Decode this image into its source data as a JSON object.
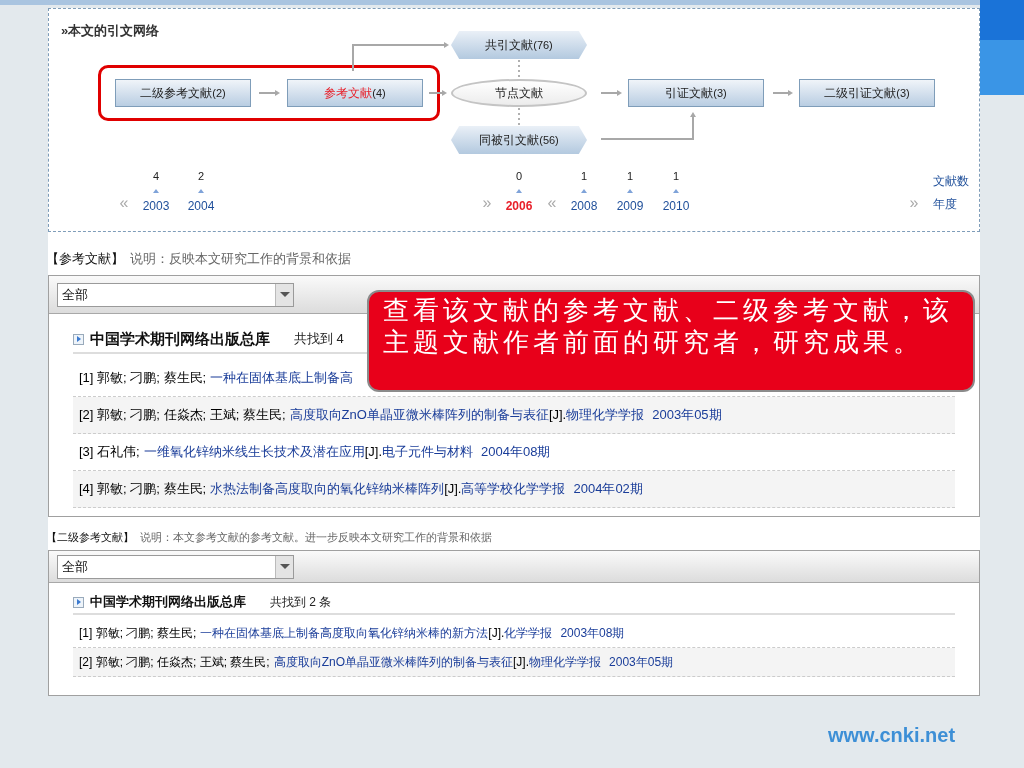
{
  "network": {
    "title": "»本文的引文网络",
    "nodes": [
      {
        "kind": "box",
        "label": "二级参考文献",
        "count": "(2)",
        "selected": false,
        "highlighted": true
      },
      {
        "kind": "box",
        "label": "参考文献",
        "count": "(4)",
        "selected": true,
        "highlighted": true
      },
      {
        "kind": "tag",
        "label": "共引文献",
        "count": "(76)",
        "selected": false,
        "highlighted": false
      },
      {
        "kind": "ellipse",
        "label": "节点文献",
        "selected": false,
        "highlighted": false
      },
      {
        "kind": "tag",
        "label": "同被引文献",
        "count": "(56)",
        "selected": false,
        "highlighted": false
      },
      {
        "kind": "box",
        "label": "引证文献",
        "count": "(3)",
        "selected": false,
        "highlighted": false
      },
      {
        "kind": "box",
        "label": "二级引证文献",
        "count": "(3)",
        "selected": false,
        "highlighted": false
      }
    ],
    "timeline": [
      {
        "kind": "nav",
        "label": "«"
      },
      {
        "kind": "year",
        "count": "4",
        "year": "2003",
        "selected": false
      },
      {
        "kind": "year",
        "count": "2",
        "year": "2004",
        "selected": false
      },
      {
        "kind": "nav",
        "label": "»"
      },
      {
        "kind": "year",
        "count": "0",
        "year": "2006",
        "selected": true
      },
      {
        "kind": "nav",
        "label": "«"
      },
      {
        "kind": "year",
        "count": "1",
        "year": "2008",
        "selected": false
      },
      {
        "kind": "year",
        "count": "1",
        "year": "2009",
        "selected": false
      },
      {
        "kind": "year",
        "count": "1",
        "year": "2010",
        "selected": false
      },
      {
        "kind": "nav",
        "label": "»"
      }
    ],
    "axis_labels": [
      "文献数",
      "年度"
    ]
  },
  "sections": [
    {
      "heading": "【参考文献】",
      "note": "说明：反映本文研究工作的背景和依据",
      "filter": "全部",
      "database": "中国学术期刊网络出版总库",
      "found": "共找到 4",
      "entries": [
        {
          "number": "[1]",
          "authors": "郭敏; 刁鹏; 蔡生民;",
          "title": "一种在固体基底上制备高"
        },
        {
          "number": "[2]",
          "authors": "郭敏; 刁鹏; 任焱杰; 王斌; 蔡生民;",
          "title": "高度取向ZnO单晶亚微米棒阵列的制备与表征",
          "type": "[J].",
          "journal": "物理化学学报",
          "date": "2003年05期"
        },
        {
          "number": "[3]",
          "authors": "石礼伟;",
          "title": "一维氧化锌纳米线生长技术及潜在应用",
          "type": "[J].",
          "journal": "电子元件与材料",
          "date": "2004年08期"
        },
        {
          "number": "[4]",
          "authors": "郭敏; 刁鹏; 蔡生民;",
          "title": "水热法制备高度取向的氧化锌纳米棒阵列",
          "type": "[J].",
          "journal": "高等学校化学学报",
          "date": "2004年02期"
        }
      ]
    },
    {
      "heading": "【二级参考文献】",
      "note": "说明：本文参考文献的参考文献。进一步反映本文研究工作的背景和依据",
      "filter": "全部",
      "database": "中国学术期刊网络出版总库",
      "found": "共找到 2 条",
      "entries": [
        {
          "number": "[1]",
          "authors": "郭敏; 刁鹏; 蔡生民;",
          "title": "一种在固体基底上制备高度取向氧化锌纳米棒的新方法",
          "type": "[J].",
          "journal": "化学学报",
          "date": "2003年08期"
        },
        {
          "number": "[2]",
          "authors": "郭敏; 刁鹏; 任焱杰; 王斌; 蔡生民;",
          "title": "高度取向ZnO单晶亚微米棒阵列的制备与表征",
          "type": "[J].",
          "journal": "物理化学学报",
          "date": "2003年05期"
        }
      ]
    }
  ],
  "callout": "查看该文献的参考文献、二级参考文献，该主题文献作者前面的研究者，研究成果。",
  "footer": "www.cnki.net"
}
